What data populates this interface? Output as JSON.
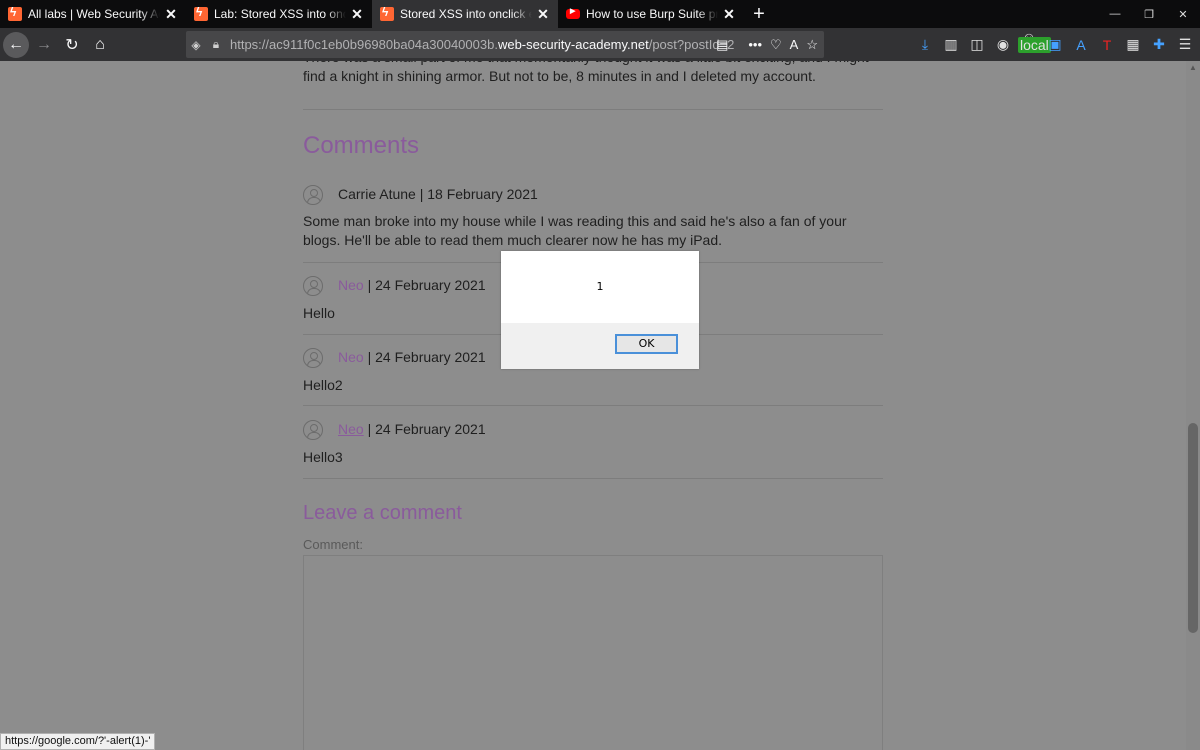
{
  "browser": {
    "tabs": [
      {
        "title": "All labs | Web Security Academy",
        "favicon": "portswigger-icon"
      },
      {
        "title": "Lab: Stored XSS into onclick event",
        "favicon": "portswigger-icon"
      },
      {
        "title": "Stored XSS into onclick event w",
        "favicon": "portswigger-icon",
        "active": true
      },
      {
        "title": "How to use Burp Suite projects",
        "favicon": "youtube-icon"
      }
    ],
    "url_scheme": "https://ac911f0c1eb0b96980ba04a30040003b.",
    "url_host": "web-security-academy.net",
    "url_path": "/post?postId=2",
    "extension_badge": "local"
  },
  "post": {
    "tail_text": "There was a small part of me that momentarily thought it was a little bit exciting, and I might find a knight in shining armor. But not to be, 8 minutes in and I deleted my account."
  },
  "comments": {
    "heading": "Comments",
    "items": [
      {
        "author": "Carrie Atune",
        "date": " | 18 February 2021",
        "body": "Some man broke into my house while I was reading this and said he's also a fan of your blogs. He'll be able to read them much clearer now he has my iPad."
      },
      {
        "author": "Neo",
        "date": " | 24 February 2021",
        "body": "Hello"
      },
      {
        "author": "Neo",
        "date": " | 24 February 2021",
        "body": "Hello2"
      },
      {
        "author": "Neo",
        "date": " | 24 February 2021",
        "body": "Hello3"
      }
    ]
  },
  "leave_comment": {
    "heading": "Leave a comment",
    "comment_label": "Comment:"
  },
  "status_bar": "https://google.com/?'-alert(1)-'",
  "alert": {
    "message": "1",
    "ok_label": "OK"
  }
}
